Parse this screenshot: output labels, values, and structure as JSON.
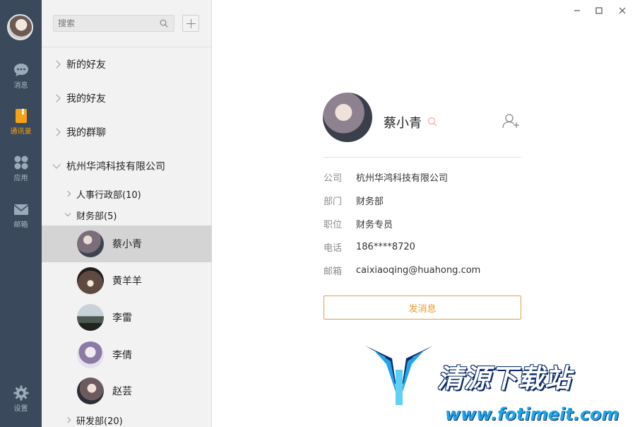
{
  "rail": {
    "items": [
      {
        "label": "消息",
        "icon": "chat-bubble-icon"
      },
      {
        "label": "通讯录",
        "icon": "contacts-book-icon",
        "active": true
      },
      {
        "label": "应用",
        "icon": "apps-grid-icon"
      },
      {
        "label": "邮箱",
        "icon": "mail-icon"
      },
      {
        "label": "设置",
        "icon": "gear-icon"
      }
    ]
  },
  "search": {
    "placeholder": "搜索"
  },
  "tree": {
    "groups": [
      "新的好友",
      "我的好友",
      "我的群聊",
      "杭州华鸿科技有限公司"
    ],
    "departments": [
      "人事行政部(10)",
      "财务部(5)",
      "研发部(20)"
    ],
    "contacts": [
      "蔡小青",
      "黄羊羊",
      "李雷",
      "李倩",
      "赵芸"
    ]
  },
  "profile": {
    "name": "蔡小青",
    "fields": [
      {
        "label": "公司",
        "value": "杭州华鸿科技有限公司"
      },
      {
        "label": "部门",
        "value": "财务部"
      },
      {
        "label": "职位",
        "value": "财务专员"
      },
      {
        "label": "电话",
        "value": "186****8720"
      },
      {
        "label": "邮箱",
        "value": "caixiaoqing@huahong.com"
      }
    ],
    "send_label": "发消息"
  },
  "watermark": {
    "title": "清源下载站",
    "url": "www.fotimeit.com"
  },
  "colors": {
    "rail_bg": "#3a4a5c",
    "accent": "#f6a015",
    "panel_bg": "#f2f2f2"
  }
}
